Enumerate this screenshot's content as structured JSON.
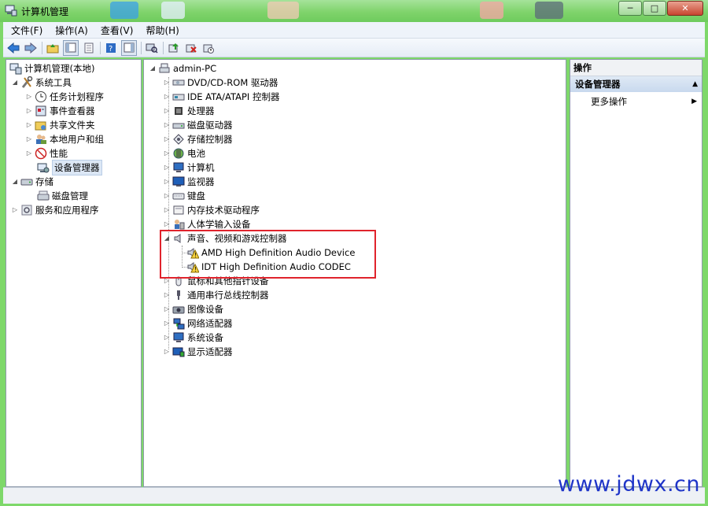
{
  "window": {
    "title": "计算机管理",
    "buttons": {
      "minimize": "─",
      "maximize": "□",
      "close": "✕"
    }
  },
  "menu": [
    "文件(F)",
    "操作(A)",
    "查看(V)",
    "帮助(H)"
  ],
  "toolbar_icons": [
    "back-icon",
    "forward-icon",
    "up-folder-icon",
    "show-hide-tree-icon",
    "properties-icon",
    "help-icon",
    "action-pane-icon",
    "scan-hardware-icon",
    "update-driver-icon",
    "uninstall-icon",
    "disable-icon"
  ],
  "left_tree": {
    "root": "计算机管理(本地)",
    "system_tools": "系统工具",
    "system_tools_items": [
      "任务计划程序",
      "事件查看器",
      "共享文件夹",
      "本地用户和组",
      "性能",
      "设备管理器"
    ],
    "storage": "存储",
    "storage_items": [
      "磁盘管理"
    ],
    "services": "服务和应用程序"
  },
  "device_tree": {
    "root": "admin-PC",
    "categories_before": [
      "DVD/CD-ROM 驱动器",
      "IDE ATA/ATAPI 控制器",
      "处理器",
      "磁盘驱动器",
      "存储控制器",
      "电池",
      "计算机",
      "监视器",
      "键盘",
      "内存技术驱动程序",
      "人体学输入设备"
    ],
    "expanded_category": "声音、视频和游戏控制器",
    "expanded_children": [
      "AMD High Definition Audio Device",
      "IDT High Definition Audio CODEC"
    ],
    "categories_after": [
      "鼠标和其他指针设备",
      "通用串行总线控制器",
      "图像设备",
      "网络适配器",
      "系统设备",
      "显示适配器"
    ]
  },
  "actions": {
    "header": "操作",
    "section": "设备管理器",
    "more": "更多操作"
  },
  "watermark": "www.jdwx.cn",
  "colors": {
    "title_bar": "#7fd36b",
    "highlight_border": "#e0232c",
    "watermark": "#1f35c8"
  }
}
